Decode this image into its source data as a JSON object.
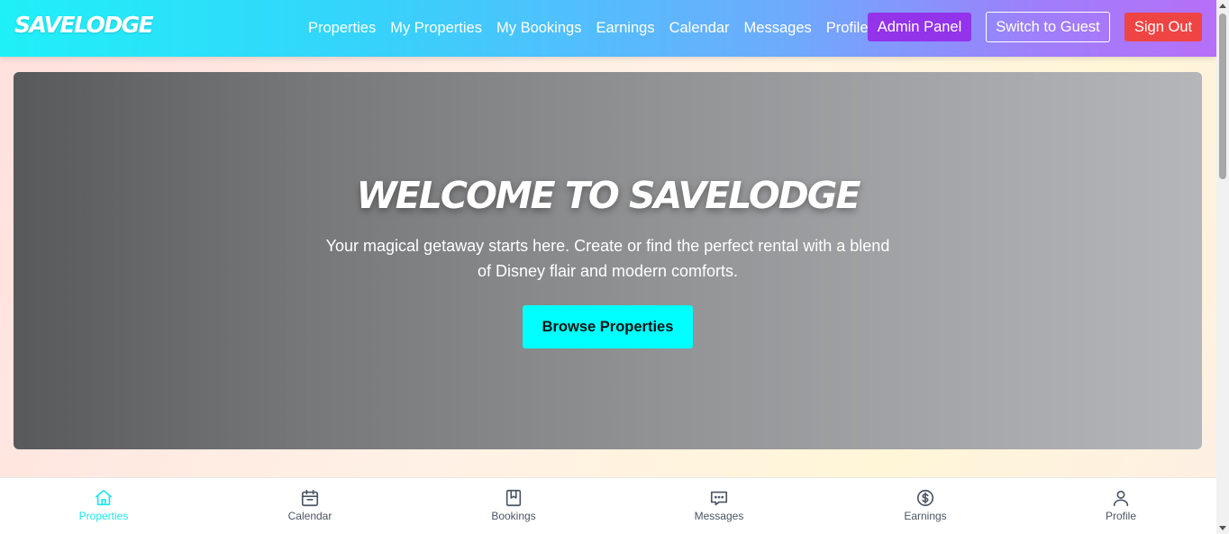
{
  "brand": {
    "logo": "SAVELODGE"
  },
  "nav": {
    "links": [
      "Properties",
      "My Properties",
      "My Bookings",
      "Earnings",
      "Calendar",
      "Messages",
      "Profile"
    ],
    "admin_label": "Admin Panel",
    "guest_label": "Switch to Guest",
    "signout_label": "Sign Out"
  },
  "hero": {
    "title": "Welcome to SaveLodge",
    "text": "Your magical getaway starts here. Create or find the perfect rental with a blend of Disney flair and modern comforts.",
    "button_label": "Browse Properties"
  },
  "bottom_nav": {
    "items": [
      {
        "label": "Properties",
        "icon": "home-icon",
        "active": true
      },
      {
        "label": "Calendar",
        "icon": "calendar-icon",
        "active": false
      },
      {
        "label": "Bookings",
        "icon": "book-icon",
        "active": false
      },
      {
        "label": "Messages",
        "icon": "chat-icon",
        "active": false
      },
      {
        "label": "Earnings",
        "icon": "dollar-icon",
        "active": false
      },
      {
        "label": "Profile",
        "icon": "user-icon",
        "active": false
      }
    ]
  },
  "colors": {
    "accent_cyan": "#00ffff",
    "admin_purple": "#9333ea",
    "signout_red": "#ef4444",
    "active_tab": "#1ee6f0"
  }
}
